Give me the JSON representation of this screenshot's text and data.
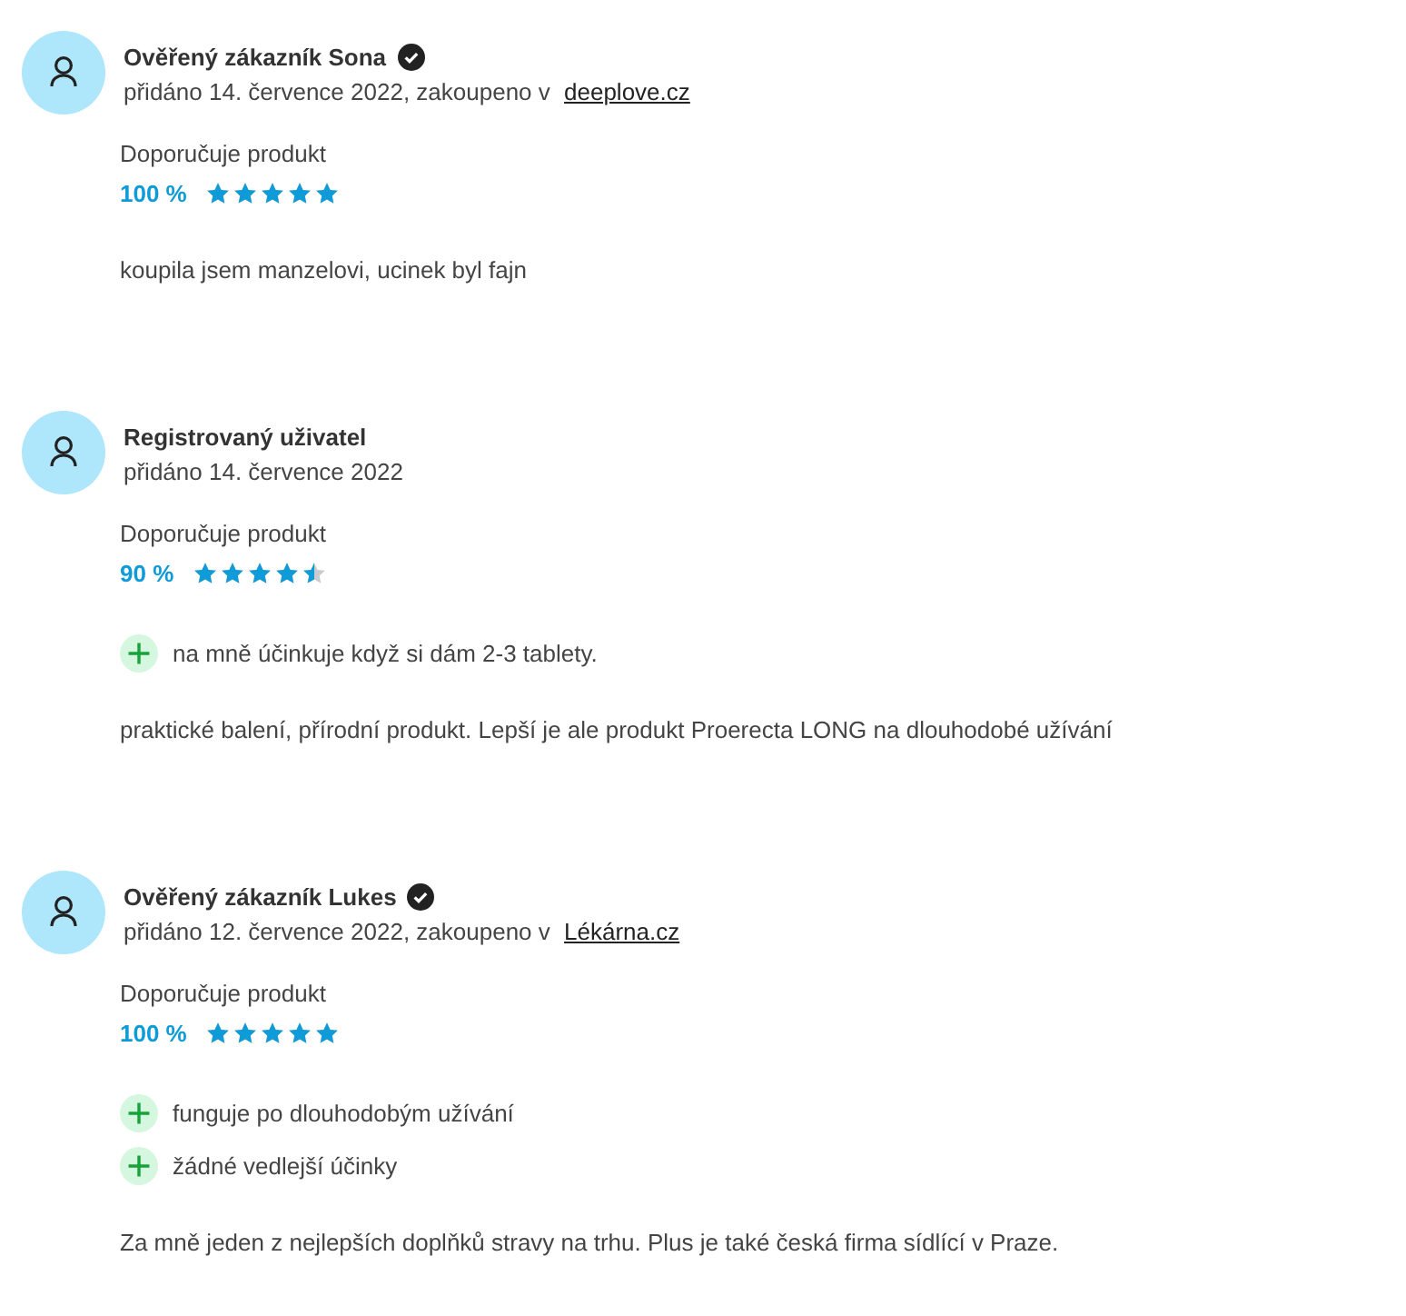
{
  "reviews": [
    {
      "author": "Ověřený zákazník Sona",
      "verified": true,
      "meta": "přidáno 14. července 2022, zakoupeno v",
      "shop": "deeplove.cz",
      "recommend_label": "Doporučuje produkt",
      "percent": "100 %",
      "stars": 5,
      "text": "koupila jsem manzelovi, ucinek byl fajn"
    },
    {
      "author": "Registrovaný uživatel",
      "verified": false,
      "meta": "přidáno 14. července 2022",
      "recommend_label": "Doporučuje produkt",
      "percent": "90 %",
      "stars": 4.5,
      "pros": [
        "na mně účinkuje když si dám 2-3 tablety."
      ],
      "text": "praktické balení, přírodní produkt. Lepší je ale produkt Proerecta LONG na dlouhodobé užívání"
    },
    {
      "author": "Ověřený zákazník Lukes",
      "verified": true,
      "meta": "přidáno 12. července 2022, zakoupeno v",
      "shop": "Lékárna.cz",
      "recommend_label": "Doporučuje produkt",
      "percent": "100 %",
      "stars": 5,
      "pros": [
        "funguje po dlouhodobým užívání",
        "žádné vedlejší účinky"
      ],
      "text": "Za mně jeden z nejlepších doplňků stravy na trhu. Plus je také česká firma sídlící v Praze."
    }
  ]
}
